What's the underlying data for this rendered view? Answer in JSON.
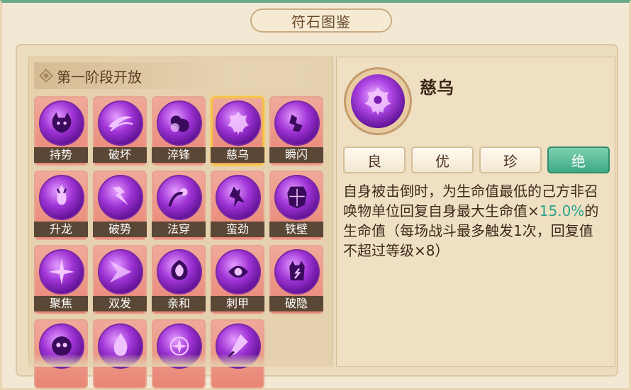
{
  "window": {
    "title": "符石图鉴"
  },
  "stage": {
    "title": "第一阶段开放"
  },
  "runes": [
    {
      "name": "持势",
      "icon": "horned-demon-icon"
    },
    {
      "name": "破坏",
      "icon": "slash-wave-icon"
    },
    {
      "name": "淬锋",
      "icon": "smoke-fist-icon"
    },
    {
      "name": "慈乌",
      "icon": "phoenix-icon"
    },
    {
      "name": "瞬闪",
      "icon": "dash-figure-icon"
    },
    {
      "name": "升龙",
      "icon": "rising-demon-icon"
    },
    {
      "name": "破势",
      "icon": "horned-strike-icon"
    },
    {
      "name": "法穿",
      "icon": "orb-pierce-icon"
    },
    {
      "name": "蛮劲",
      "icon": "brute-figure-icon"
    },
    {
      "name": "铁壁",
      "icon": "iron-shield-icon"
    },
    {
      "name": "聚焦",
      "icon": "star-burst-icon"
    },
    {
      "name": "双发",
      "icon": "double-slash-icon"
    },
    {
      "name": "亲和",
      "icon": "lotus-shield-icon"
    },
    {
      "name": "刺甲",
      "icon": "spiral-eye-icon"
    },
    {
      "name": "破隐",
      "icon": "lightning-demon-icon"
    },
    {
      "name": "",
      "icon": "ghost-face-icon"
    },
    {
      "name": "",
      "icon": "flame-icon"
    },
    {
      "name": "",
      "icon": "compass-star-icon"
    },
    {
      "name": "",
      "icon": "crystal-sword-icon"
    }
  ],
  "selected": {
    "name": "慈乌",
    "icon": "phoenix-icon",
    "grades": [
      "良",
      "优",
      "珍",
      "绝"
    ],
    "active_grade": "绝",
    "description_pre": "自身被击倒时，为生命值最低的己方非召唤物单位回复自身最大生命值×",
    "description_value": "15.0%",
    "description_post": "的生命值（每场战斗最多触发1次，回复值不超过等级×8）"
  },
  "colors": {
    "accent": "#3fa884",
    "highlight": "#2aa38a",
    "selected_border": "#f6c244",
    "label_bg": "#5b4735"
  }
}
